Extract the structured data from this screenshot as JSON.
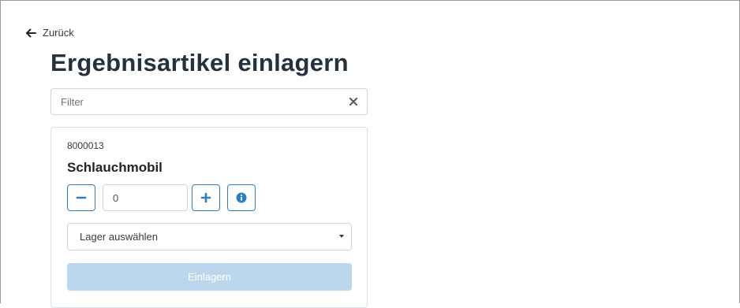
{
  "navigation": {
    "back_label": "Zurück"
  },
  "page": {
    "title": "Ergebnisartikel einlagern"
  },
  "filter": {
    "placeholder": "Filter",
    "value": ""
  },
  "article": {
    "number": "8000013",
    "name": "Schlauchmobil",
    "quantity": "0",
    "warehouse_select": {
      "selected_label": "Lager auswählen"
    },
    "submit_label": "Einlagern",
    "submit_disabled": true
  },
  "icons": {
    "back": "arrow-left-icon",
    "clear_filter": "close-icon",
    "decrement": "minus-icon",
    "increment": "plus-icon",
    "info": "info-circle-icon",
    "select": "caret-down-icon"
  },
  "colors": {
    "accent": "#2f7fc1",
    "submit_disabled_bg": "#bcd6ee",
    "title": "#25313d"
  }
}
